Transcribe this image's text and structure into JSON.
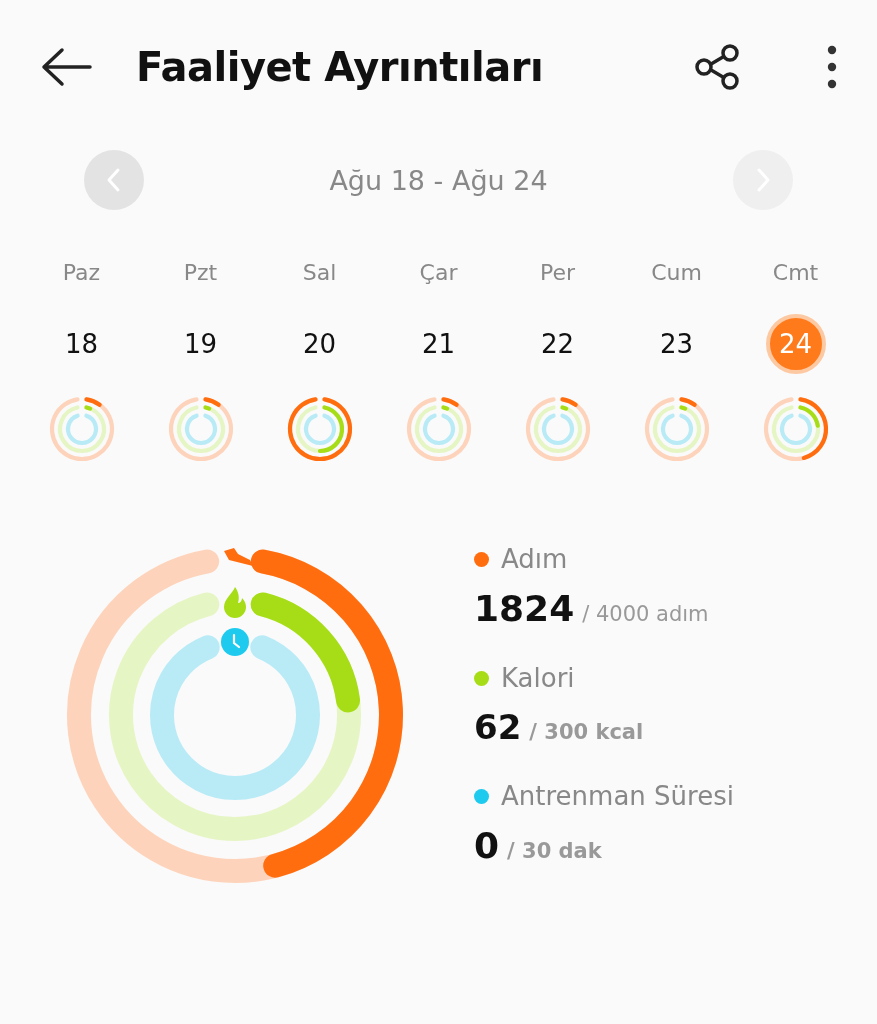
{
  "header": {
    "title": "Faaliyet Ayrıntıları"
  },
  "week_nav": {
    "range": "Ağu 18 - Ağu 24",
    "prev": {
      "disabled": false
    },
    "next": {
      "disabled": true
    }
  },
  "days": [
    {
      "weekday": "Paz",
      "date": "18",
      "selected": false
    },
    {
      "weekday": "Pzt",
      "date": "19",
      "selected": false
    },
    {
      "weekday": "Sal",
      "date": "20",
      "selected": false
    },
    {
      "weekday": "Çar",
      "date": "21",
      "selected": false
    },
    {
      "weekday": "Per",
      "date": "22",
      "selected": false
    },
    {
      "weekday": "Cum",
      "date": "23",
      "selected": false
    },
    {
      "weekday": "Cmt",
      "date": "24",
      "selected": true
    }
  ],
  "summary": {
    "metrics": [
      {
        "kind": "steps",
        "label": "Adım",
        "value": "1824",
        "goal": "/ 4000 adım",
        "color": "#ff6d0f"
      },
      {
        "kind": "calories",
        "label": "Kalori",
        "value": "62",
        "goal": "/ 300 kcal",
        "color": "#a6dd16"
      },
      {
        "kind": "duration",
        "label": "Antrenman Süresi",
        "value": "0",
        "goal": "/ 30 dak",
        "color": "#1ecbee"
      }
    ]
  }
}
